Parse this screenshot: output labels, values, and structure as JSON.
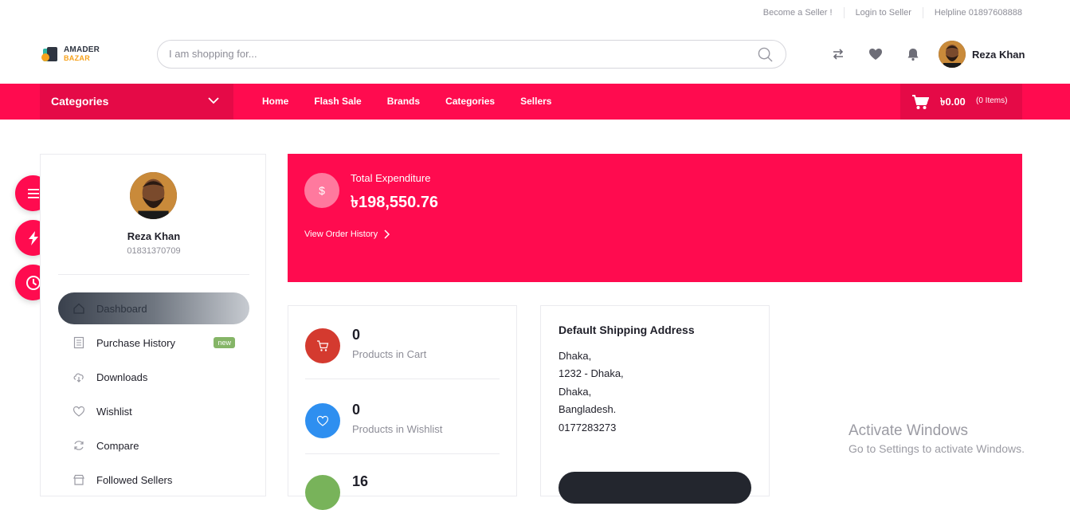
{
  "topbar": {
    "become_seller": "Become a Seller !",
    "login_seller": "Login to Seller",
    "helpline": "Helpline 01897608888"
  },
  "logo": {
    "line1": "AMADER",
    "line2": "BAZAR"
  },
  "search": {
    "placeholder": "I am shopping for..."
  },
  "header": {
    "icons": [
      "compare-icon",
      "heart-icon",
      "bell-icon"
    ],
    "user_name": "Reza Khan"
  },
  "nav": {
    "categories_label": "Categories",
    "links": [
      "Home",
      "Flash Sale",
      "Brands",
      "Categories",
      "Sellers"
    ],
    "cart_amount": "৳0.00",
    "cart_items": "(0 Items)"
  },
  "profile": {
    "name": "Reza Khan",
    "phone": "01831370709"
  },
  "menu": [
    {
      "label": "Dashboard",
      "icon": "home-icon",
      "active": true
    },
    {
      "label": "Purchase History",
      "icon": "receipt-icon",
      "badge": "new"
    },
    {
      "label": "Downloads",
      "icon": "cloud-download-icon"
    },
    {
      "label": "Wishlist",
      "icon": "heart-icon"
    },
    {
      "label": "Compare",
      "icon": "refresh-icon"
    },
    {
      "label": "Followed Sellers",
      "icon": "store-icon"
    }
  ],
  "summary": {
    "currency_symbol": "$",
    "total_label": "Total Expenditure",
    "total_value": "৳198,550.76",
    "history_link": "View Order History"
  },
  "stats": [
    {
      "value": "0",
      "label": "Products in Cart",
      "color": "#d43a2f"
    },
    {
      "value": "0",
      "label": "Products in Wishlist",
      "color": "#2e8ff0"
    },
    {
      "value": "16",
      "label": "",
      "color": "#78b35a"
    }
  ],
  "address": {
    "title": "Default Shipping Address",
    "lines": [
      "Dhaka,",
      "1232 - Dhaka,",
      "Dhaka,",
      "Bangladesh.",
      "0177283273"
    ]
  },
  "watermark": {
    "line1": "Activate Windows",
    "line2": "Go to Settings to activate Windows."
  },
  "colors": {
    "brand": "#ff0b4f",
    "brand_dark": "#e50a47"
  }
}
